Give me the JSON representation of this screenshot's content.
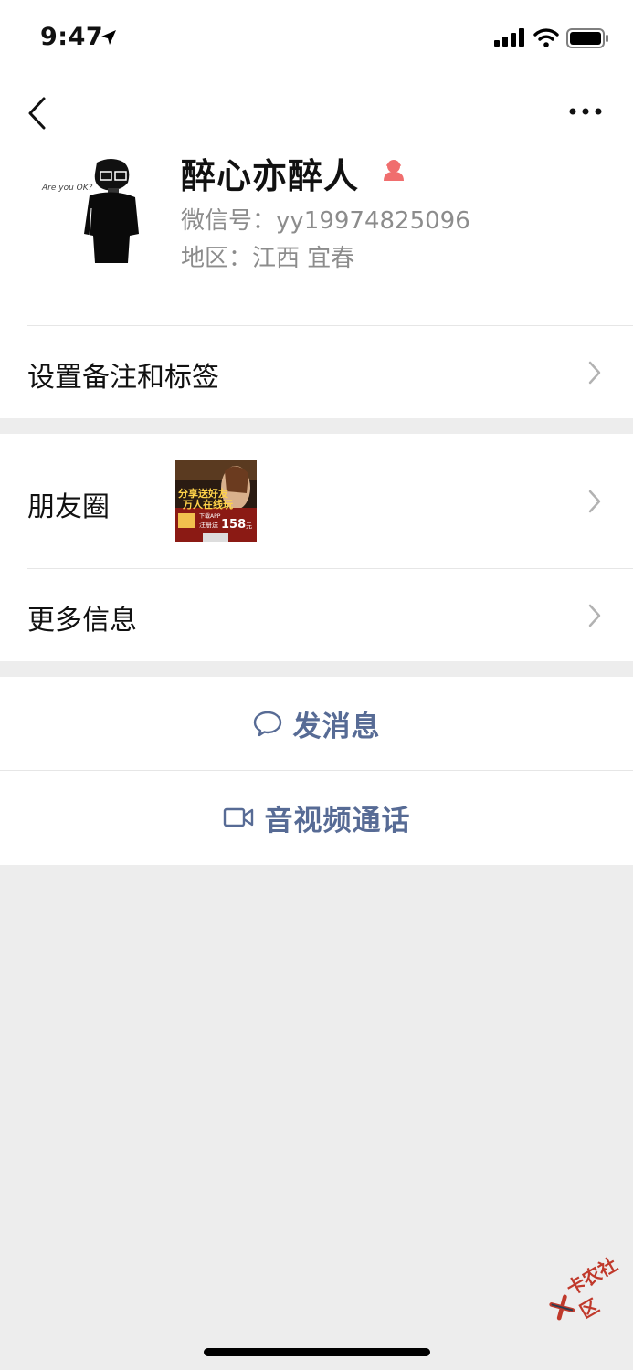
{
  "status_bar": {
    "time": "9:47"
  },
  "profile": {
    "name": "醉心亦醉人",
    "wechat_id": "微信号：yy19974825096",
    "region": "地区：江西 宜春",
    "gender": "female",
    "avatar_caption": "Are you OK?",
    "remark_label": "设置备注和标签"
  },
  "moments": {
    "label": "朋友圈",
    "thumb": {
      "line1": "分享送好友",
      "line2": "万人在线玩",
      "line3": "下载APP",
      "line4": "注册送",
      "amount": "158",
      "unit": "元"
    }
  },
  "more_info": {
    "label": "更多信息"
  },
  "actions": {
    "message_label": "发消息",
    "call_label": "音视频通话"
  },
  "watermark": {
    "text": "卡农社区"
  },
  "colors": {
    "accent": "#576b95",
    "gender_female": "#f06e6e",
    "secondary_text": "#8c8c8c",
    "background": "#ededed"
  }
}
